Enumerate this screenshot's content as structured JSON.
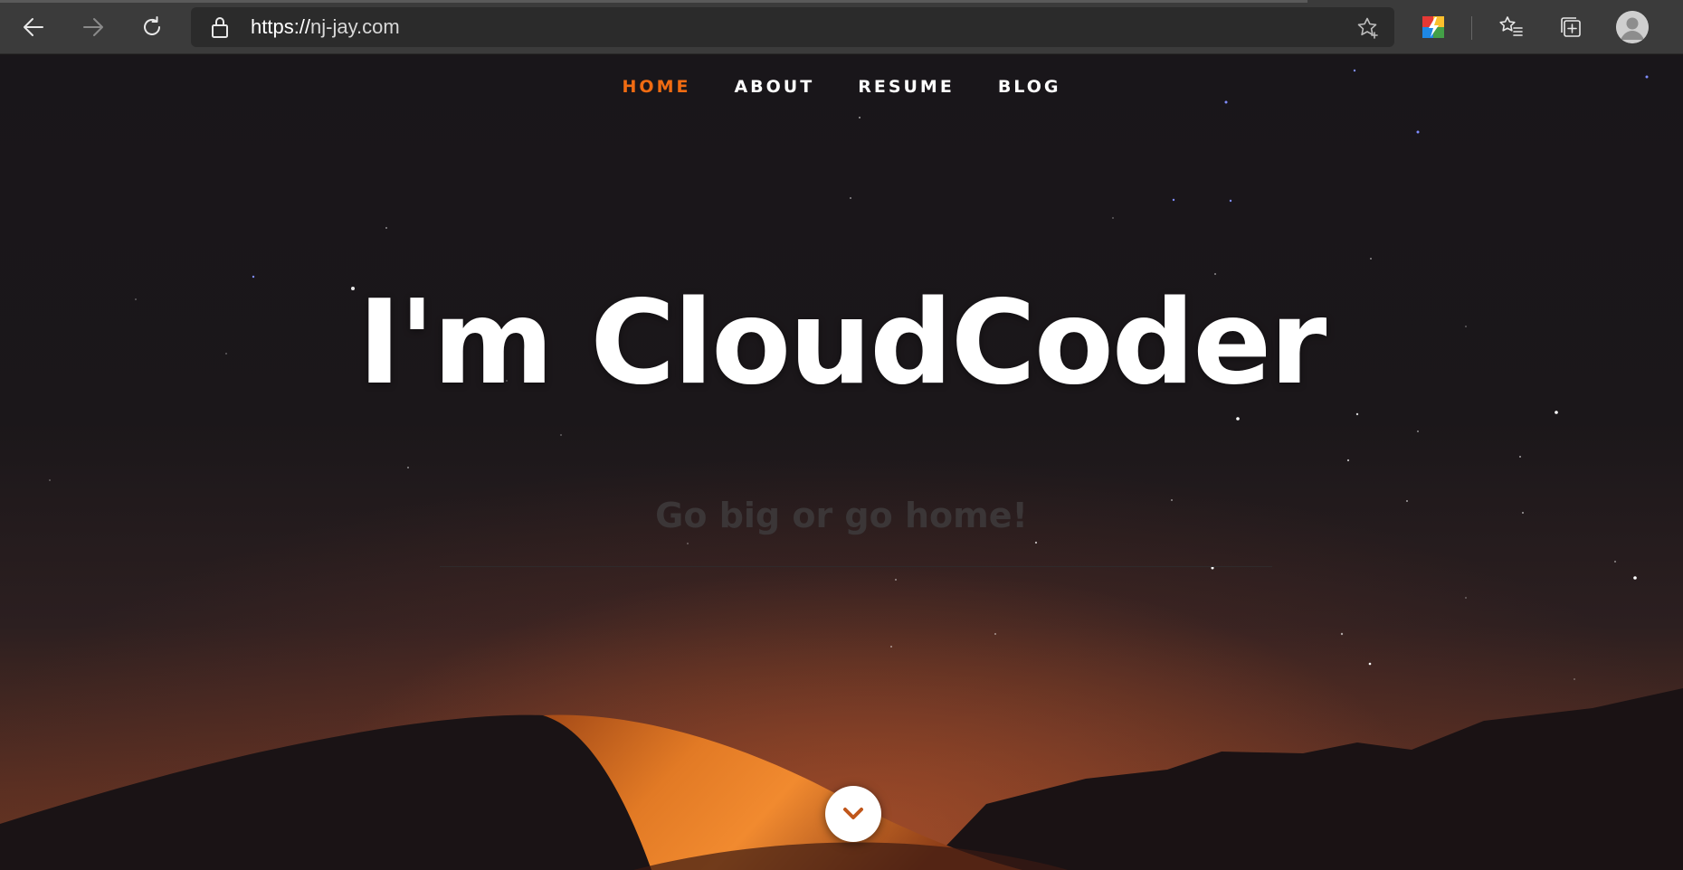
{
  "browser": {
    "url_protocol": "https://",
    "url_host": "nj-jay.com",
    "icons": {
      "back": "back-arrow-icon",
      "forward": "forward-arrow-icon",
      "refresh": "refresh-icon",
      "lock": "lock-icon",
      "favorite": "star-add-icon",
      "extension": "extension-icon",
      "favorites": "favorites-list-icon",
      "collections": "collections-icon",
      "profile": "profile-avatar-icon"
    }
  },
  "nav": {
    "items": [
      {
        "label": "HOME",
        "active": true
      },
      {
        "label": "ABOUT",
        "active": false
      },
      {
        "label": "RESUME",
        "active": false
      },
      {
        "label": "BLOG",
        "active": false
      }
    ]
  },
  "hero": {
    "title": "I'm CloudCoder",
    "subtitle": "Go big or go home!",
    "scroll_icon": "chevron-down-icon"
  },
  "colors": {
    "accent": "#f06b12",
    "nav_text": "#ffffff",
    "chrome_bg": "#3b3b3b",
    "omnibox_bg": "#2b2b2b",
    "page_bg": "#1a1719"
  }
}
